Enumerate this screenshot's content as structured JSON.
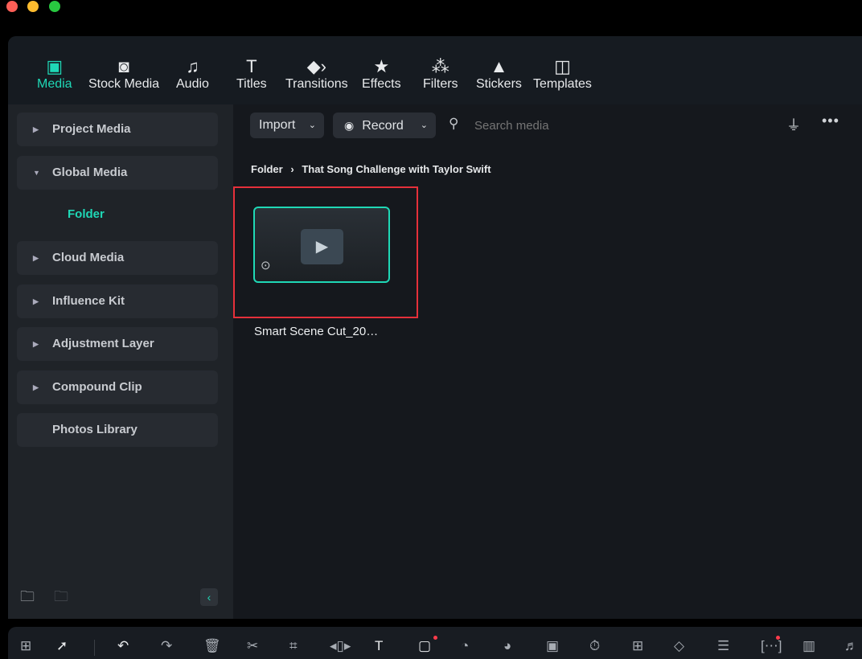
{
  "toolbar": {
    "tabs": [
      {
        "label": "Media",
        "icon": "media-icon",
        "active": true
      },
      {
        "label": "Stock Media",
        "icon": "stock-media-icon"
      },
      {
        "label": "Audio",
        "icon": "music-note-icon"
      },
      {
        "label": "Titles",
        "icon": "text-t-icon"
      },
      {
        "label": "Transitions",
        "icon": "transitions-icon"
      },
      {
        "label": "Effects",
        "icon": "effects-star-icon"
      },
      {
        "label": "Filters",
        "icon": "filters-icon"
      },
      {
        "label": "Stickers",
        "icon": "stickers-icon"
      },
      {
        "label": "Templates",
        "icon": "templates-icon"
      }
    ]
  },
  "sidebar": {
    "items": [
      {
        "label": "Project Media"
      },
      {
        "label": "Global Media",
        "expanded": true
      },
      {
        "label": "Folder"
      },
      {
        "label": "Cloud Media"
      },
      {
        "label": "Influence Kit"
      },
      {
        "label": "Adjustment Layer"
      },
      {
        "label": "Compound Clip"
      },
      {
        "label": "Photos Library"
      }
    ]
  },
  "main": {
    "import_label": "Import",
    "record_label": "Record",
    "search_placeholder": "Search media",
    "breadcrumb": {
      "root": "Folder",
      "current": "That Song Challenge with Taylor Swift"
    },
    "clips": [
      {
        "name": "Smart Scene Cut_20…"
      }
    ]
  },
  "colors": {
    "accent": "#1fd8b6",
    "highlight_box": "#e5303a"
  }
}
